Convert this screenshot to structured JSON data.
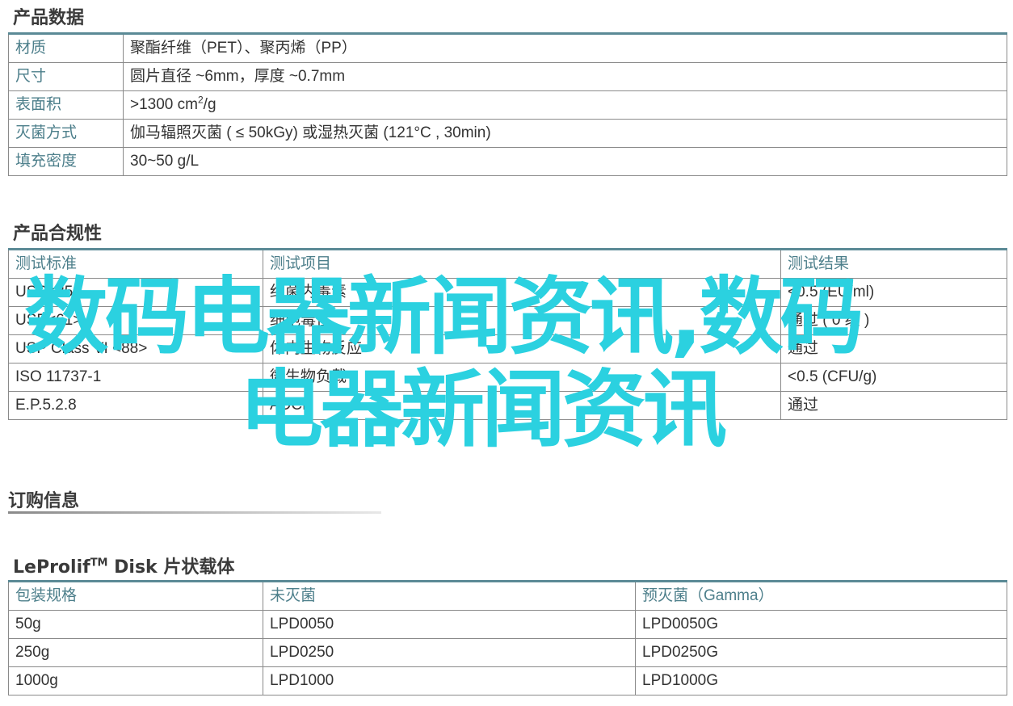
{
  "product_data": {
    "title": "产品数据",
    "rows": [
      {
        "label": "材质",
        "value": "聚酯纤维（PET）、聚丙烯（PP）"
      },
      {
        "label": "尺寸",
        "value": "圆片直径 ~6mm，厚度 ~0.7mm"
      },
      {
        "label": "表面积",
        "value_prefix": ">1300 cm",
        "value_sup": "2",
        "value_suffix": "/g"
      },
      {
        "label": "灭菌方式",
        "value": "伽马辐照灭菌 ( ≤ 50kGy) 或湿热灭菌 (121°C , 30min)"
      },
      {
        "label": "填充密度",
        "value": "30~50 g/L"
      }
    ]
  },
  "compliance": {
    "title": "产品合规性",
    "headers": [
      "测试标准",
      "测试项目",
      "测试结果"
    ],
    "rows": [
      [
        "USP<85>",
        "细菌内毒素",
        "<0.5 (EU/ml)"
      ],
      [
        "USP<61>",
        "细胞毒性",
        "通过 ( 0 级 )"
      ],
      [
        "USP Class VI <88>",
        "体内生物反应",
        "通过"
      ],
      [
        "ISO 11737-1",
        "微生物负载",
        "<0.5 (CFU/g)"
      ],
      [
        "E.P.5.2.8",
        "ADCF",
        "通过"
      ]
    ]
  },
  "ordering": {
    "title": "订购信息"
  },
  "disk_table": {
    "title_brand": "LeProlif",
    "title_tm": "TM",
    "title_rest": " Disk 片状载体",
    "headers": [
      "包装规格",
      "未灭菌",
      "预灭菌（Gamma）"
    ],
    "rows": [
      [
        "50g",
        "LPD0050",
        "LPD0050G"
      ],
      [
        "250g",
        "LPD0250",
        "LPD0250G"
      ],
      [
        "1000g",
        "LPD1000",
        "LPD1000G"
      ]
    ]
  },
  "watermark": {
    "line1": "数码电器新闻资讯,数码",
    "line2": "电器新闻资讯",
    "color": "#2bd1e0"
  }
}
